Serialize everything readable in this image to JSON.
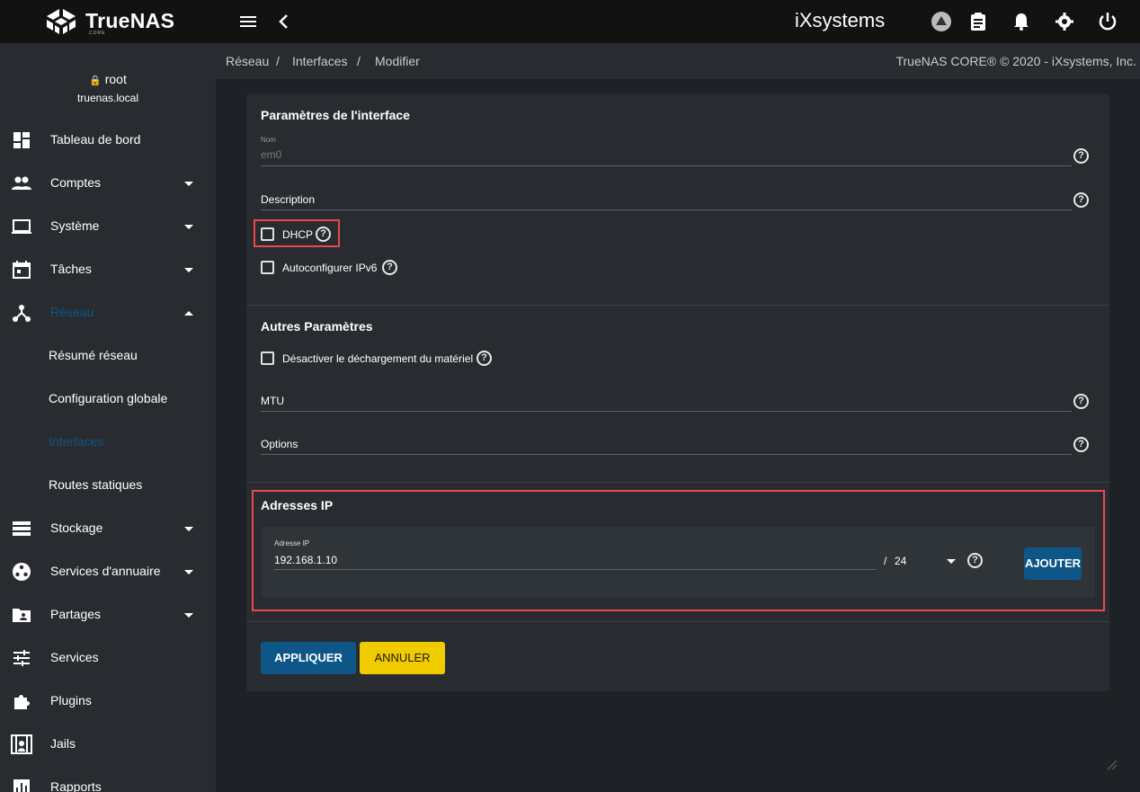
{
  "header": {
    "logo_text": "TrueNAS",
    "logo_sub": "CORE",
    "vendor_logo": "iXsystems",
    "icons": [
      "menu-icon",
      "chevron-left-icon",
      "truecommand-icon",
      "clipboard-icon",
      "bell-icon",
      "gear-icon",
      "power-icon"
    ]
  },
  "sidebar": {
    "user": "root",
    "host": "truenas.local",
    "items": [
      {
        "label": "Tableau de bord",
        "icon": "dashboard-icon"
      },
      {
        "label": "Comptes",
        "icon": "people-icon"
      },
      {
        "label": "Système",
        "icon": "laptop-icon"
      },
      {
        "label": "Tâches",
        "icon": "calendar-icon"
      },
      {
        "label": "Réseau",
        "icon": "network-icon"
      },
      {
        "label": "Résumé réseau"
      },
      {
        "label": "Configuration globale"
      },
      {
        "label": "Interfaces"
      },
      {
        "label": "Routes statiques"
      },
      {
        "label": "Stockage",
        "icon": "storage-icon"
      },
      {
        "label": "Services d'annuaire",
        "icon": "directory-icon"
      },
      {
        "label": "Partages",
        "icon": "folder-shared-icon"
      },
      {
        "label": "Services",
        "icon": "tune-icon"
      },
      {
        "label": "Plugins",
        "icon": "puzzle-icon"
      },
      {
        "label": "Jails",
        "icon": "jail-icon"
      },
      {
        "label": "Rapports",
        "icon": "chart-icon"
      }
    ],
    "active_color": "#0d5687"
  },
  "breadcrumb": {
    "items": [
      "Réseau",
      "Interfaces",
      "Modifier"
    ],
    "separator": "/",
    "copyright": "TrueNAS CORE® © 2020 - iXsystems, Inc."
  },
  "form": {
    "section1_title": "Paramètres de l'interface",
    "name_label": "Nom",
    "name_value": "em0",
    "description_label": "Description",
    "dhcp_label": "DHCP",
    "ipv6_label": "Autoconfigurer IPv6",
    "section2_title": "Autres Paramètres",
    "offload_label": "Désactiver le déchargement du matériel",
    "mtu_label": "MTU",
    "options_label": "Options",
    "section3_title": "Adresses IP",
    "ip_label": "Adresse IP",
    "ip_value": "192.168.1.10",
    "netmask_sep": "/",
    "netmask_value": "24",
    "add_button": "AJOUTER",
    "apply_button": "APPLIQUER",
    "cancel_button": "ANNULER",
    "help_glyph": "?"
  },
  "colors": {
    "primary": "#0d5687",
    "accent": "#f0cb00",
    "highlight": "#e84a4a"
  }
}
